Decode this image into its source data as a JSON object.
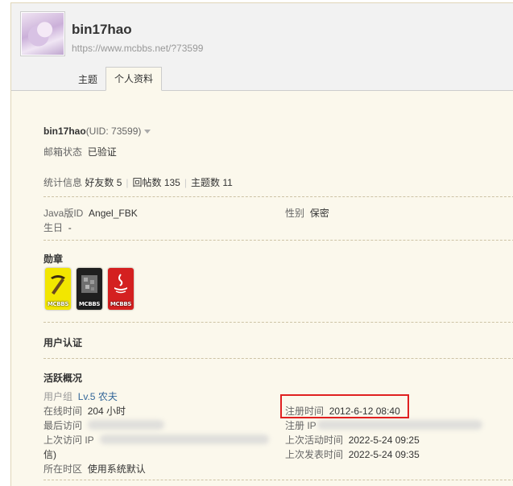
{
  "header": {
    "username": "bin17hao",
    "url": "https://www.mcbbs.net/?73599",
    "tabs": [
      "主题",
      "个人资料"
    ],
    "active_tab": "个人资料"
  },
  "profile": {
    "name": "bin17hao",
    "uid": "(UID: 73599)",
    "email_label": "邮箱状态",
    "email_value": "已验证",
    "stats_label": "统计信息",
    "stats": [
      "好友数 5",
      "回帖数 135",
      "主题数 11"
    ],
    "java_label": "Java版ID",
    "java_value": "Angel_FBK",
    "gender_label": "性别",
    "gender_value": "保密",
    "birthday_label": "生日",
    "birthday_value": "-"
  },
  "medals": {
    "title": "勋章",
    "items": [
      {
        "tag": "MCBBS",
        "color": "#f2e600",
        "icon": "pickaxe-icon"
      },
      {
        "tag": "MCBBS",
        "color": "#1f1f1f",
        "icon": "ore-icon"
      },
      {
        "tag": "MCBBS",
        "color": "#d42020",
        "icon": "java-icon"
      }
    ]
  },
  "verification": {
    "title": "用户认证"
  },
  "activity": {
    "title": "活跃概况",
    "group_label": "用户组",
    "group_value": "Lv.5 农夫",
    "online_label": "在线时间",
    "online_value": "204 小时",
    "last_visit_label": "最后访问",
    "last_ip_label": "上次访问 IP",
    "last_ip_tail": "信)",
    "timezone_label": "所在时区",
    "timezone_value": "使用系统默认",
    "reg_time_label": "注册时间",
    "reg_time_value": "2012-6-12 08:40",
    "reg_ip_label": "注册 IP",
    "last_active_label": "上次活动时间",
    "last_active_value": "2022-5-24 09:25",
    "last_post_label": "上次发表时间",
    "last_post_value": "2022-5-24 09:35"
  },
  "colors": {
    "highlight": "#e02020",
    "link": "#336699",
    "background": "#fbf8ec"
  }
}
